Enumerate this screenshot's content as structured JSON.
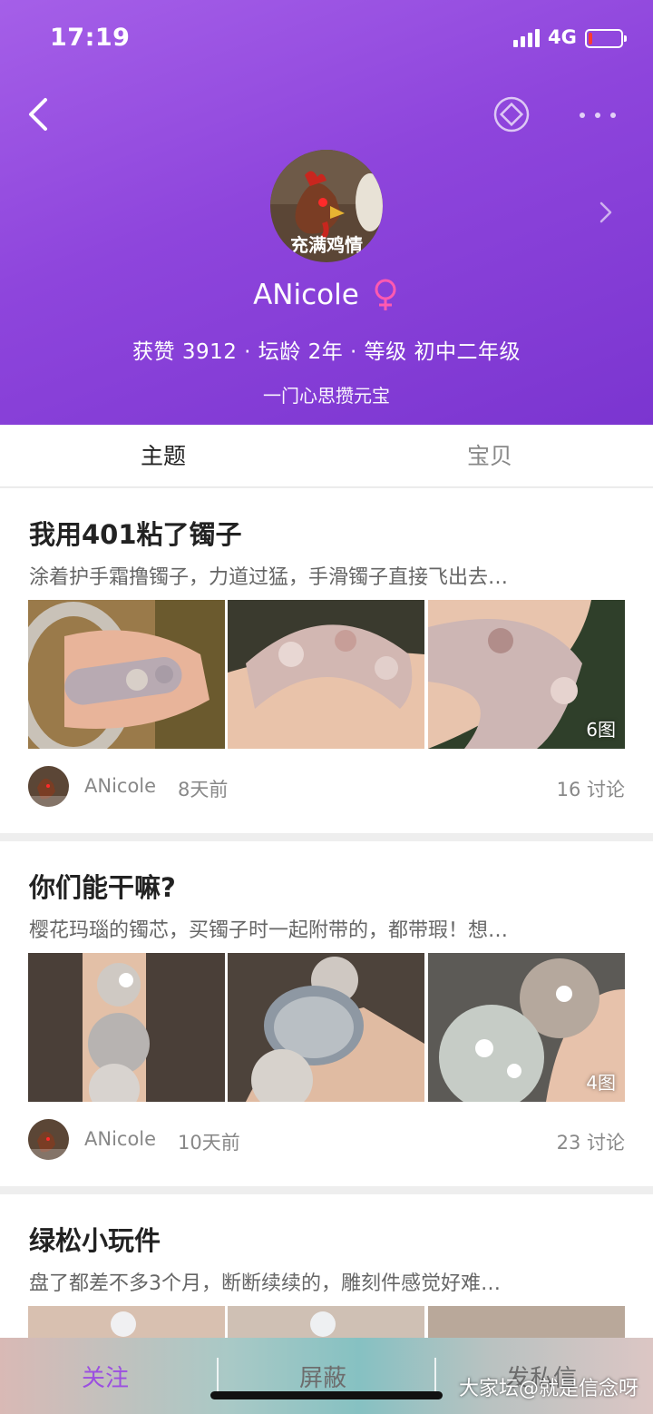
{
  "status_bar": {
    "time": "17:19",
    "network": "4G",
    "battery_level": 0.12,
    "battery_color": "#ff3b30"
  },
  "header": {
    "gradient_start": "#a55fe8",
    "gradient_end": "#7b35d0",
    "avatar_text": "充满鸡情",
    "username": "ANicole",
    "gender_icon": "female-symbol-icon",
    "stats": "获赞 3912 · 坛龄 2年 · 等级 初中二年级",
    "motto": "一门心思攒元宝"
  },
  "tabs": [
    {
      "label": "主题",
      "active": true
    },
    {
      "label": "宝贝",
      "active": false
    }
  ],
  "posts": [
    {
      "title": "我用401粘了镯子",
      "excerpt": "涂着护手霜撸镯子，力道过猛，手滑镯子直接飞出去…",
      "image_count": "6图",
      "author": "ANicole",
      "time": "8天前",
      "discussions": "16 讨论"
    },
    {
      "title": "你们能干嘛?",
      "excerpt": "樱花玛瑙的镯芯，买镯子时一起附带的，都带瑕！想…",
      "image_count": "4图",
      "author": "ANicole",
      "time": "10天前",
      "discussions": "23 讨论"
    },
    {
      "title": "绿松小玩件",
      "excerpt": "盘了都差不多3个月，断断续续的，雕刻件感觉好难…"
    }
  ],
  "bottom_bar": {
    "follow": "关注",
    "block": "屏蔽",
    "message": "发私信",
    "accent": "#9b4fe0"
  },
  "watermark": "大家坛@就是信念呀"
}
